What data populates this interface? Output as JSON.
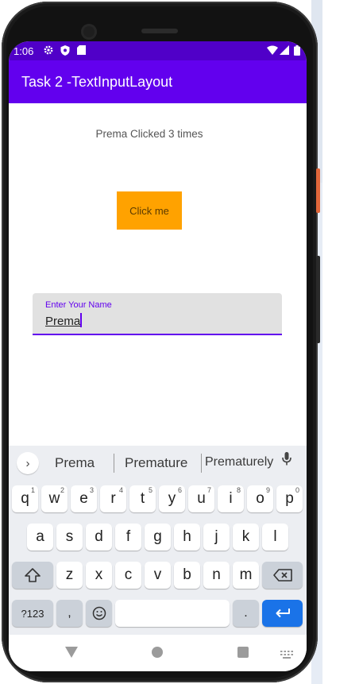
{
  "status_bar": {
    "time": "1:06",
    "icons": [
      "gear-icon",
      "shield-icon",
      "sd-card-icon",
      "wifi-icon",
      "signal-icon",
      "battery-icon"
    ]
  },
  "app_bar": {
    "title": "Task 2 -TextInputLayout"
  },
  "main": {
    "click_count_text": "Prema Clicked 3 times",
    "click_button_label": "Click me",
    "name_field": {
      "label": "Enter Your Name",
      "value": "Prema"
    }
  },
  "keyboard": {
    "suggestions": [
      "Prema",
      "Premature",
      "Prematurely"
    ],
    "row1": [
      {
        "key": "q",
        "hint": "1"
      },
      {
        "key": "w",
        "hint": "2"
      },
      {
        "key": "e",
        "hint": "3"
      },
      {
        "key": "r",
        "hint": "4"
      },
      {
        "key": "t",
        "hint": "5"
      },
      {
        "key": "y",
        "hint": "6"
      },
      {
        "key": "u",
        "hint": "7"
      },
      {
        "key": "i",
        "hint": "8"
      },
      {
        "key": "o",
        "hint": "9"
      },
      {
        "key": "p",
        "hint": "0"
      }
    ],
    "row2": [
      "a",
      "s",
      "d",
      "f",
      "g",
      "h",
      "j",
      "k",
      "l"
    ],
    "row3": [
      "z",
      "x",
      "c",
      "v",
      "b",
      "n",
      "m"
    ],
    "symbols_label": "?123",
    "comma_label": ",",
    "period_label": "."
  },
  "nav_bar": {
    "icons": [
      "back-icon",
      "home-icon",
      "recents-icon",
      "keyboard-switch-icon"
    ]
  },
  "colors": {
    "status_bar": "#5000c8",
    "app_bar": "#6200ee",
    "button": "#ffa200",
    "accent": "#6200ee",
    "enter_key": "#1a73e8"
  }
}
